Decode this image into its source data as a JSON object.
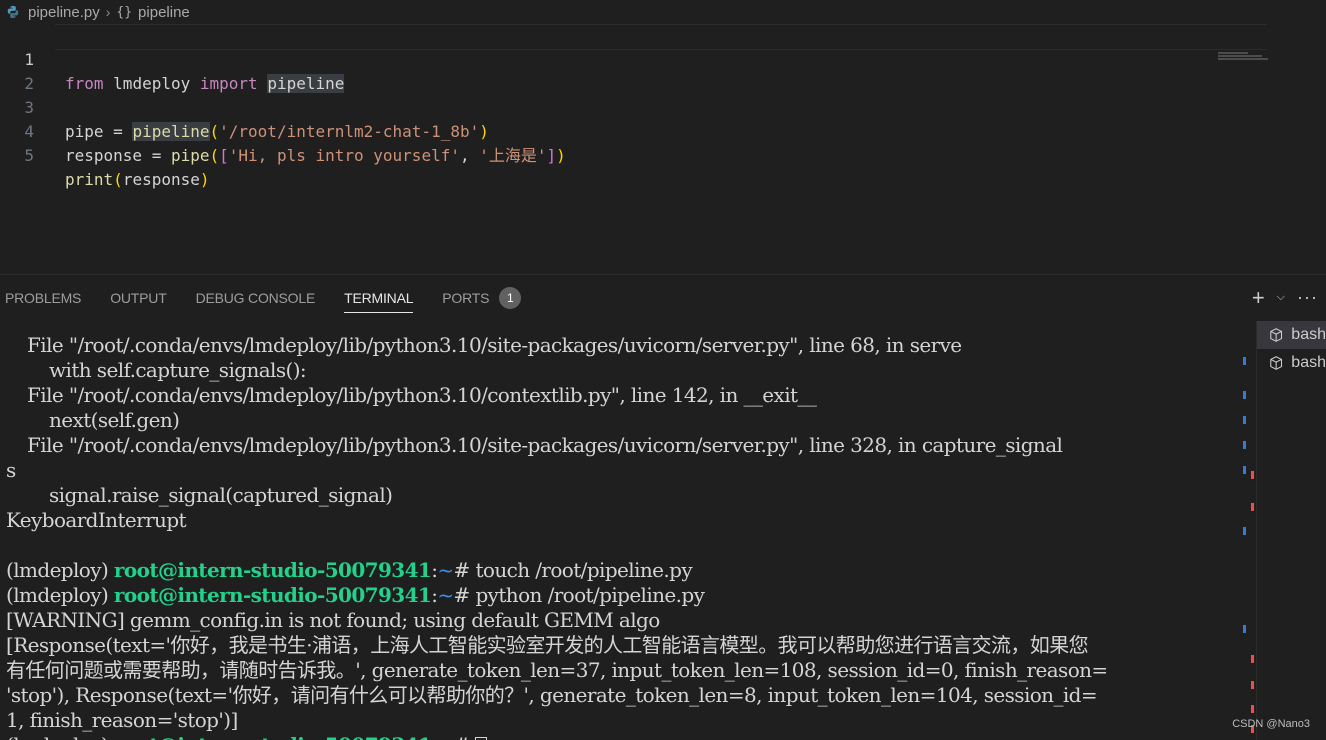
{
  "breadcrumb": {
    "file": "pipeline.py",
    "symbol": "pipeline"
  },
  "editor": {
    "line_numbers": [
      "1",
      "2",
      "3",
      "4",
      "5"
    ],
    "line1": {
      "kw_from": "from",
      "module": "lmdeploy",
      "kw_import": "import",
      "name": "pipeline"
    },
    "line3": {
      "var": "pipe",
      "eq": " = ",
      "fn": "pipeline",
      "open": "(",
      "arg": "'/root/internlm2-chat-1_8b'",
      "close": ")"
    },
    "line4": {
      "var": "response",
      "eq": " = ",
      "fn": "pipe",
      "open": "(",
      "lb": "[",
      "s1": "'Hi, pls intro yourself'",
      "comma": ", ",
      "s2": "'上海是'",
      "rb": "]",
      "close": ")"
    },
    "line5": {
      "fn": "print",
      "open": "(",
      "arg": "response",
      "close": ")"
    }
  },
  "panel": {
    "tabs": [
      "PROBLEMS",
      "OUTPUT",
      "DEBUG CONSOLE",
      "TERMINAL",
      "PORTS"
    ],
    "ports_badge": "1",
    "actions": {
      "add": "+",
      "dropdown": "⌵",
      "more": "···"
    }
  },
  "terminal": {
    "lines": [
      "File \"/root/.conda/envs/lmdeploy/lib/python3.10/site-packages/uvicorn/server.py\", line 68, in serve",
      "with self.capture_signals():",
      "File \"/root/.conda/envs/lmdeploy/lib/python3.10/contextlib.py\", line 142, in __exit__",
      "next(self.gen)",
      "File \"/root/.conda/envs/lmdeploy/lib/python3.10/site-packages/uvicorn/server.py\", line 328, in capture_signal",
      "s",
      "signal.raise_signal(captured_signal)",
      "KeyboardInterrupt",
      "",
      "[WARNING] gemm_config.in is not found; using default GEMM algo",
      "[Response(text='你好，我是书生·浦语，上海人工智能实验室开发的人工智能语言模型。我可以帮助您进行语言交流，如果您",
      "有任何问题或需要帮助，请随时告诉我。', generate_token_len=37, input_token_len=108, session_id=0, finish_reason=",
      "'stop'), Response(text='你好，请问有什么可以帮助你的？', generate_token_len=8, input_token_len=104, session_id=",
      "1, finish_reason='stop')]"
    ],
    "prompt": {
      "env": "(lmdeploy) ",
      "host": "root@intern-studio-50079341",
      "colon": ":",
      "path": "~",
      "dollar": "# "
    },
    "commands": [
      "touch /root/pipeline.py",
      "python /root/pipeline.py"
    ],
    "instances": [
      "bash",
      "bash"
    ]
  },
  "colors": {
    "background": "#1f1f1f",
    "prompt_green": "#23d18b",
    "prompt_blue": "#3b8eea",
    "keyword": "#c586c0",
    "string": "#ce9178",
    "function": "#dcdcaa"
  },
  "watermark": "CSDN @Nano3"
}
